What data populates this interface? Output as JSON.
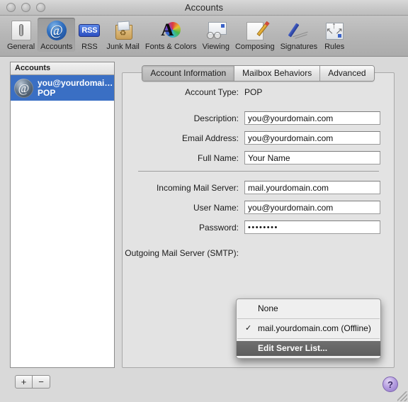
{
  "window": {
    "title": "Accounts",
    "traffic_lights": [
      "close",
      "minimize",
      "zoom"
    ]
  },
  "toolbar": {
    "items": [
      {
        "label": "General",
        "icon": "general-icon"
      },
      {
        "label": "Accounts",
        "icon": "at-sign-icon",
        "selected": true
      },
      {
        "label": "RSS",
        "icon": "rss-icon"
      },
      {
        "label": "Junk Mail",
        "icon": "junk-mail-icon"
      },
      {
        "label": "Fonts & Colors",
        "icon": "fonts-colors-icon"
      },
      {
        "label": "Viewing",
        "icon": "viewing-icon"
      },
      {
        "label": "Composing",
        "icon": "composing-icon"
      },
      {
        "label": "Signatures",
        "icon": "signatures-icon"
      },
      {
        "label": "Rules",
        "icon": "rules-icon"
      }
    ]
  },
  "sidebar": {
    "header": "Accounts",
    "account": {
      "name": "you@yourdomai…",
      "type": "POP",
      "icon": "at-globe-icon",
      "selected": true
    },
    "add_button": "+",
    "remove_button": "−"
  },
  "tabs": [
    {
      "label": "Account Information",
      "active": true
    },
    {
      "label": "Mailbox Behaviors",
      "active": false
    },
    {
      "label": "Advanced",
      "active": false
    }
  ],
  "form": {
    "account_type_label": "Account Type:",
    "account_type_value": "POP",
    "fields": [
      {
        "label": "Description:",
        "value": "you@yourdomain.com",
        "type": "text"
      },
      {
        "label": "Email Address:",
        "value": "you@yourdomain.com",
        "type": "text"
      },
      {
        "label": "Full Name:",
        "value": "Your Name",
        "type": "text"
      }
    ],
    "fields2": [
      {
        "label": "Incoming Mail Server:",
        "value": "mail.yourdomain.com",
        "type": "text"
      },
      {
        "label": "User Name:",
        "value": "you@yourdomain.com",
        "type": "text"
      },
      {
        "label": "Password:",
        "value": "••••••••",
        "type": "password"
      }
    ],
    "smtp_label": "Outgoing Mail Server (SMTP):"
  },
  "popup_menu": {
    "items": [
      {
        "label": "None",
        "checked": false,
        "highlighted": false
      },
      {
        "label": "mail.yourdomain.com (Offline)",
        "checked": true,
        "highlighted": false
      },
      {
        "label": "Edit Server List...",
        "checked": false,
        "highlighted": true
      }
    ],
    "check_glyph": "✓"
  },
  "help": {
    "label": "?"
  },
  "colors": {
    "selection_blue": "#3a6fc4",
    "menu_highlight": "#5d5d5d",
    "window_bg": "#d9d9d9",
    "panel_bg": "#e3e3e3"
  }
}
